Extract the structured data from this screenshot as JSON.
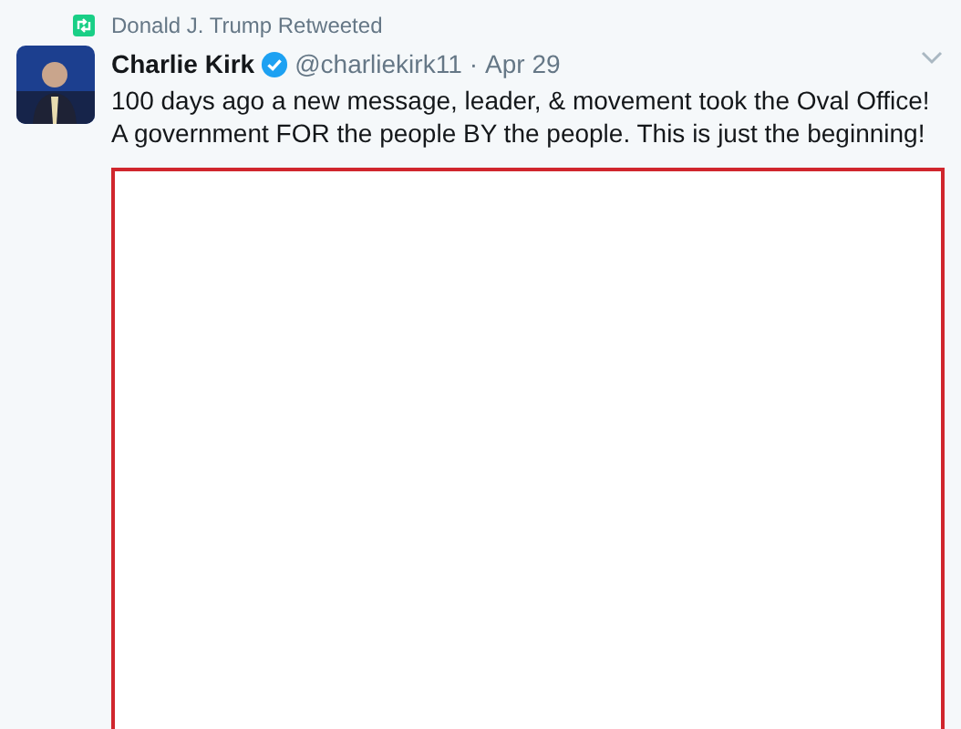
{
  "retweet_context": {
    "label": "Donald J. Trump Retweeted"
  },
  "tweet": {
    "name": "Charlie Kirk",
    "verified": true,
    "handle": "@charliekirk11",
    "separator": "·",
    "date": "Apr 29",
    "text": "100 days ago a new message, leader, & movement took the Oval Office! A government FOR the people BY the people. This is just the beginning!",
    "media": {
      "kind": "empty-frame"
    }
  }
}
